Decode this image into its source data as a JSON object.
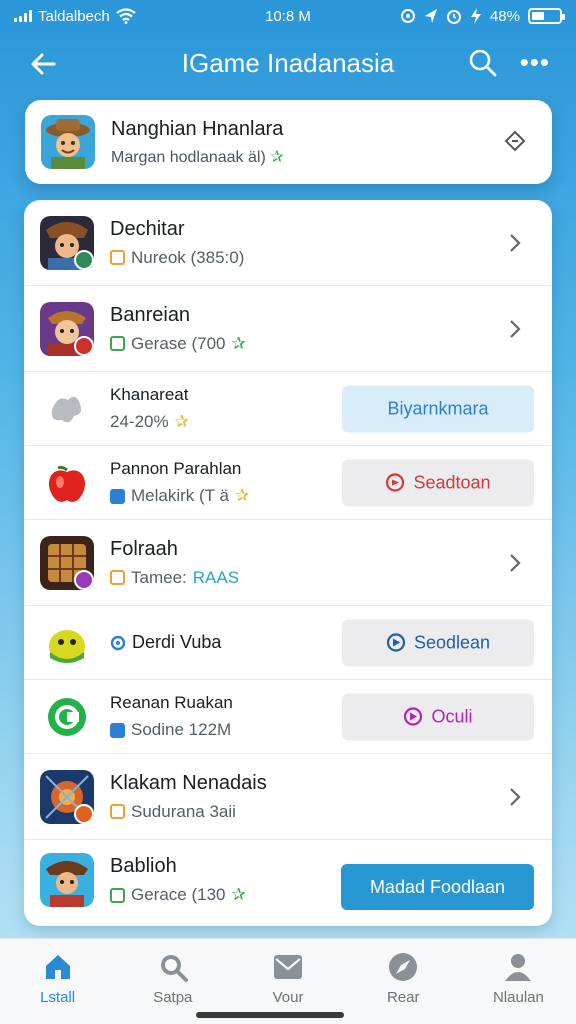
{
  "status_bar": {
    "carrier": "Taldalbech",
    "time": "10:8 M",
    "battery": "48%",
    "battery_level": 0.48
  },
  "header": {
    "title": "IGame Inadanasia"
  },
  "featured": {
    "title": "Nanghian Hnanlara",
    "subtitle": "Margan hodlanaak äl)"
  },
  "games": [
    {
      "name": "Dechitar",
      "meta": "Nureok (385:0)"
    },
    {
      "name": "Banreian",
      "meta": "Gerase (700"
    },
    {
      "name": "Khanareat",
      "meta": "24-20%",
      "button": "Biyarnkmara"
    },
    {
      "name": "Pannon Parahlan",
      "meta": "Melakirk (T ä",
      "button": "Seadtoan"
    },
    {
      "name": "Folraah",
      "meta": "Tamee:",
      "meta_accent": "RAAS"
    },
    {
      "name": "",
      "meta": "Derdi Vuba",
      "button": "Seodlean"
    },
    {
      "name": "Reanan Ruakan",
      "meta": "Sodine 122M",
      "button": "Oculi"
    },
    {
      "name": "Klakam Nenadais",
      "meta": "Sudurana 3aii"
    },
    {
      "name": "Bablioh",
      "meta": "Gerace (130",
      "button": "Madad Foodlaan"
    }
  ],
  "nav": [
    {
      "label": "Lstall",
      "icon": "home-icon"
    },
    {
      "label": "Satpa",
      "icon": "search-icon"
    },
    {
      "label": "Vour",
      "icon": "mail-icon"
    },
    {
      "label": "Rear",
      "icon": "compass-icon"
    },
    {
      "label": "Nlaulan",
      "icon": "user-icon"
    }
  ],
  "colors": {
    "accent": "#2797d4",
    "background_top": "#2a96d8",
    "background_bottom": "#bfe6f6"
  }
}
